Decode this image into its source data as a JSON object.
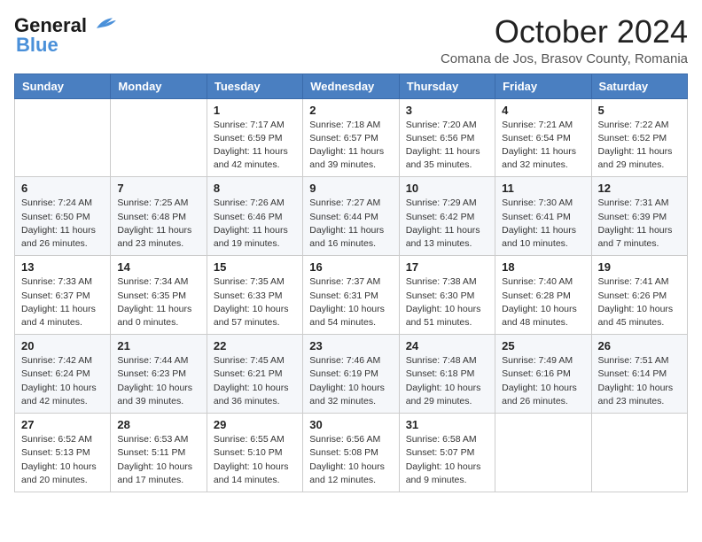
{
  "header": {
    "logo_line1": "General",
    "logo_line2": "Blue",
    "month": "October 2024",
    "location": "Comana de Jos, Brasov County, Romania"
  },
  "days_of_week": [
    "Sunday",
    "Monday",
    "Tuesday",
    "Wednesday",
    "Thursday",
    "Friday",
    "Saturday"
  ],
  "weeks": [
    [
      {
        "day": "",
        "info": ""
      },
      {
        "day": "",
        "info": ""
      },
      {
        "day": "1",
        "info": "Sunrise: 7:17 AM\nSunset: 6:59 PM\nDaylight: 11 hours and 42 minutes."
      },
      {
        "day": "2",
        "info": "Sunrise: 7:18 AM\nSunset: 6:57 PM\nDaylight: 11 hours and 39 minutes."
      },
      {
        "day": "3",
        "info": "Sunrise: 7:20 AM\nSunset: 6:56 PM\nDaylight: 11 hours and 35 minutes."
      },
      {
        "day": "4",
        "info": "Sunrise: 7:21 AM\nSunset: 6:54 PM\nDaylight: 11 hours and 32 minutes."
      },
      {
        "day": "5",
        "info": "Sunrise: 7:22 AM\nSunset: 6:52 PM\nDaylight: 11 hours and 29 minutes."
      }
    ],
    [
      {
        "day": "6",
        "info": "Sunrise: 7:24 AM\nSunset: 6:50 PM\nDaylight: 11 hours and 26 minutes."
      },
      {
        "day": "7",
        "info": "Sunrise: 7:25 AM\nSunset: 6:48 PM\nDaylight: 11 hours and 23 minutes."
      },
      {
        "day": "8",
        "info": "Sunrise: 7:26 AM\nSunset: 6:46 PM\nDaylight: 11 hours and 19 minutes."
      },
      {
        "day": "9",
        "info": "Sunrise: 7:27 AM\nSunset: 6:44 PM\nDaylight: 11 hours and 16 minutes."
      },
      {
        "day": "10",
        "info": "Sunrise: 7:29 AM\nSunset: 6:42 PM\nDaylight: 11 hours and 13 minutes."
      },
      {
        "day": "11",
        "info": "Sunrise: 7:30 AM\nSunset: 6:41 PM\nDaylight: 11 hours and 10 minutes."
      },
      {
        "day": "12",
        "info": "Sunrise: 7:31 AM\nSunset: 6:39 PM\nDaylight: 11 hours and 7 minutes."
      }
    ],
    [
      {
        "day": "13",
        "info": "Sunrise: 7:33 AM\nSunset: 6:37 PM\nDaylight: 11 hours and 4 minutes."
      },
      {
        "day": "14",
        "info": "Sunrise: 7:34 AM\nSunset: 6:35 PM\nDaylight: 11 hours and 0 minutes."
      },
      {
        "day": "15",
        "info": "Sunrise: 7:35 AM\nSunset: 6:33 PM\nDaylight: 10 hours and 57 minutes."
      },
      {
        "day": "16",
        "info": "Sunrise: 7:37 AM\nSunset: 6:31 PM\nDaylight: 10 hours and 54 minutes."
      },
      {
        "day": "17",
        "info": "Sunrise: 7:38 AM\nSunset: 6:30 PM\nDaylight: 10 hours and 51 minutes."
      },
      {
        "day": "18",
        "info": "Sunrise: 7:40 AM\nSunset: 6:28 PM\nDaylight: 10 hours and 48 minutes."
      },
      {
        "day": "19",
        "info": "Sunrise: 7:41 AM\nSunset: 6:26 PM\nDaylight: 10 hours and 45 minutes."
      }
    ],
    [
      {
        "day": "20",
        "info": "Sunrise: 7:42 AM\nSunset: 6:24 PM\nDaylight: 10 hours and 42 minutes."
      },
      {
        "day": "21",
        "info": "Sunrise: 7:44 AM\nSunset: 6:23 PM\nDaylight: 10 hours and 39 minutes."
      },
      {
        "day": "22",
        "info": "Sunrise: 7:45 AM\nSunset: 6:21 PM\nDaylight: 10 hours and 36 minutes."
      },
      {
        "day": "23",
        "info": "Sunrise: 7:46 AM\nSunset: 6:19 PM\nDaylight: 10 hours and 32 minutes."
      },
      {
        "day": "24",
        "info": "Sunrise: 7:48 AM\nSunset: 6:18 PM\nDaylight: 10 hours and 29 minutes."
      },
      {
        "day": "25",
        "info": "Sunrise: 7:49 AM\nSunset: 6:16 PM\nDaylight: 10 hours and 26 minutes."
      },
      {
        "day": "26",
        "info": "Sunrise: 7:51 AM\nSunset: 6:14 PM\nDaylight: 10 hours and 23 minutes."
      }
    ],
    [
      {
        "day": "27",
        "info": "Sunrise: 6:52 AM\nSunset: 5:13 PM\nDaylight: 10 hours and 20 minutes."
      },
      {
        "day": "28",
        "info": "Sunrise: 6:53 AM\nSunset: 5:11 PM\nDaylight: 10 hours and 17 minutes."
      },
      {
        "day": "29",
        "info": "Sunrise: 6:55 AM\nSunset: 5:10 PM\nDaylight: 10 hours and 14 minutes."
      },
      {
        "day": "30",
        "info": "Sunrise: 6:56 AM\nSunset: 5:08 PM\nDaylight: 10 hours and 12 minutes."
      },
      {
        "day": "31",
        "info": "Sunrise: 6:58 AM\nSunset: 5:07 PM\nDaylight: 10 hours and 9 minutes."
      },
      {
        "day": "",
        "info": ""
      },
      {
        "day": "",
        "info": ""
      }
    ]
  ]
}
